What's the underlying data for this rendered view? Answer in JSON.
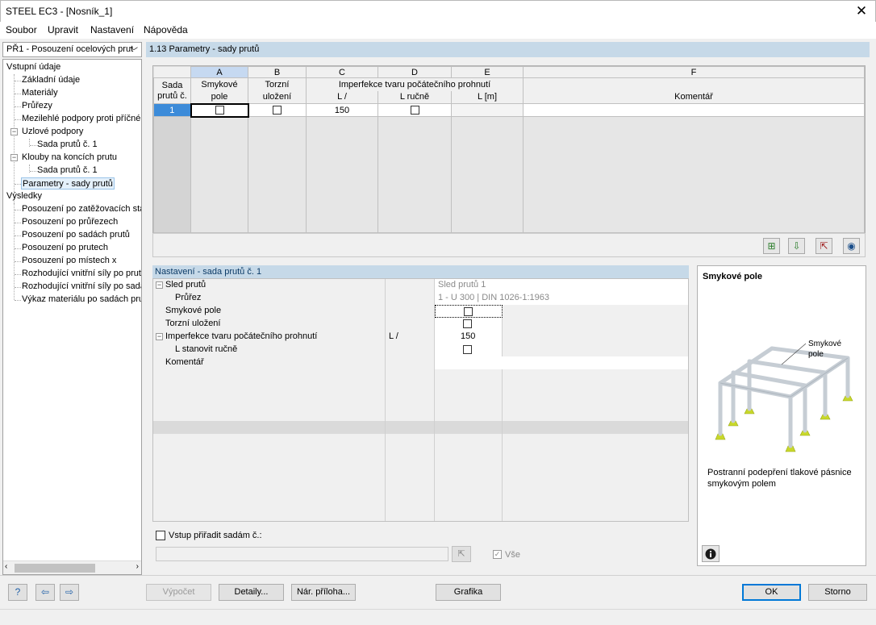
{
  "window": {
    "title": "STEEL EC3 - [Nosník_1]",
    "close_glyph": "✕"
  },
  "menu": [
    "Soubor",
    "Upravit",
    "Nastavení",
    "Nápověda"
  ],
  "nav": {
    "combo_label": "PŘ1 - Posouzení ocelových prut",
    "tree": [
      {
        "label": "Vstupní údaje"
      },
      {
        "label": "Základní údaje"
      },
      {
        "label": "Materiály"
      },
      {
        "label": "Průřezy"
      },
      {
        "label": "Mezilehlé podpory proti příčném"
      },
      {
        "label": "Uzlové podpory"
      },
      {
        "label": "Sada prutů č. 1"
      },
      {
        "label": "Klouby na koncích prutu"
      },
      {
        "label": "Sada prutů č. 1"
      },
      {
        "label": "Parametry - sady prutů"
      },
      {
        "label": "Výsledky"
      },
      {
        "label": "Posouzení po zatěžovacích stav"
      },
      {
        "label": "Posouzení po průřezech"
      },
      {
        "label": "Posouzení po sadách prutů"
      },
      {
        "label": "Posouzení po prutech"
      },
      {
        "label": "Posouzení po místech x"
      },
      {
        "label": "Rozhodující vnitřní síly po prute"
      },
      {
        "label": "Rozhodující vnitřní síly po sadác"
      },
      {
        "label": "Výkaz materiálu po sadách prut"
      }
    ]
  },
  "section_title": "1.13 Parametry - sady prutů",
  "grid": {
    "col_letters": [
      "A",
      "B",
      "C",
      "D",
      "E",
      "F"
    ],
    "row_header_top": "Sada",
    "row_header_bottom": "prutů č.",
    "a_top": "Smykové",
    "a_bottom": "pole",
    "b_top": "Torzní",
    "b_bottom": "uložení",
    "cde_group": "Imperfekce tvaru počátečního prohnutí",
    "c_sub": "L /",
    "d_sub": "L ručně",
    "e_sub": "L [m]",
    "f_sub": "Komentář",
    "row1": {
      "num": "1",
      "c_value": "150"
    }
  },
  "settings": {
    "title": "Nastavení - sada prutů č. 1",
    "rows": {
      "sled_label": "Sled prutů",
      "sled_value": "Sled prutů 1",
      "prurez_label": "Průřez",
      "prurez_value": "1 - U 300 | DIN 1026-1:1963",
      "smykove_label": "Smykové pole",
      "torzni_label": "Torzní uložení",
      "imperf_label": "Imperfekce tvaru počátečního prohnutí",
      "imperf_unit": "L /",
      "imperf_value": "150",
      "lrucne_label": "L stanovit ručně",
      "komentar_label": "Komentář"
    },
    "assign_label": "Vstup přiřadit sadám č.:",
    "all_label": "Vše"
  },
  "info": {
    "title": "Smykové pole",
    "callout": "Smykové\npole",
    "description": "Postranní podepření tlakové pásnice smykovým polem"
  },
  "footer": {
    "vypocet": "Výpočet",
    "detaily": "Detaily...",
    "priloha": "Nár. příloha...",
    "grafika": "Grafika",
    "ok": "OK",
    "storno": "Storno"
  }
}
